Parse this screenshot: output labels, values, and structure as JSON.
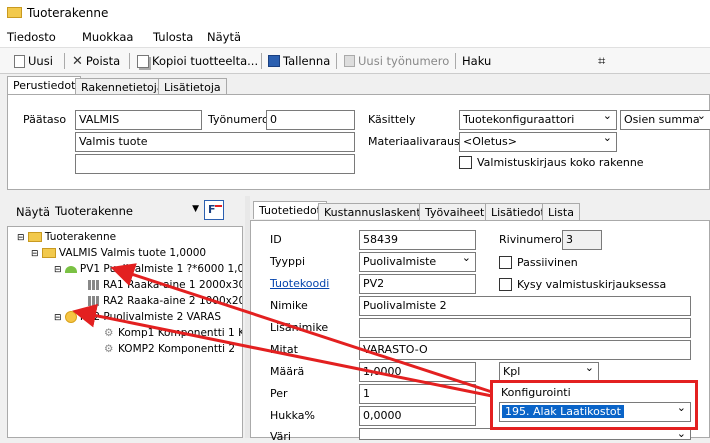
{
  "window": {
    "title": "Tuoterakenne"
  },
  "menu": [
    "Tiedosto",
    "Muokkaa",
    "Tulosta",
    "Näytä"
  ],
  "toolbar": {
    "new": "Uusi",
    "delete": "Poista",
    "copy": "Kopioi tuotteelta...",
    "save": "Tallenna",
    "new_worknum": "Uusi työnumero",
    "search": "Haku"
  },
  "top_tabs": [
    "Perustiedot",
    "Rakennetietoja",
    "Lisätietoja"
  ],
  "header": {
    "paataso_label": "Päätaso",
    "paataso_value": "VALMIS",
    "paataso_desc": "Valmis tuote",
    "tyonumero_label": "Työnumero",
    "tyonumero_value": "0",
    "kasittely_label": "Käsittely",
    "kasittely_value": "Tuotekonfiguraattori",
    "osien_summa": "Osien summa",
    "materiaalivaraus_label": "Materiaalivaraus",
    "materiaalivaraus_value": "<Oletus>",
    "valmistuskirjaus_label": "Valmistuskirjaus koko rakenne"
  },
  "tree_panel": {
    "nayta_label": "Näytä",
    "nayta_value": "Tuoterakenne",
    "nodes": [
      {
        "text": "Tuoterakenne"
      },
      {
        "text": "VALMIS  Valmis tuote  1,0000"
      },
      {
        "text": "PV1  Puolivalmiste 1 ?*6000  1,0"
      },
      {
        "text": "RA1  Raaka-aine 1 2000x30"
      },
      {
        "text": "RA2  Raaka-aine 2 1000x20"
      },
      {
        "text": "PV2  Puolivalmiste 2 VARAS"
      },
      {
        "text": "Komp1  Komponentti 1 K"
      },
      {
        "text": "KOMP2  Komponentti 2"
      }
    ]
  },
  "detail_tabs": [
    "Tuotetiedot",
    "Kustannuslaskenta",
    "Työvaiheet",
    "Lisätiedot",
    "Lista"
  ],
  "detail": {
    "id_label": "ID",
    "id_value": "58439",
    "rivinumero_label": "Rivinumero",
    "rivinumero_value": "3",
    "tyyppi_label": "Tyyppi",
    "tyyppi_value": "Puolivalmiste",
    "passiivinen_label": "Passiivinen",
    "tuotekoodi_label": "Tuotekoodi",
    "tuotekoodi_value": "PV2",
    "kysy_label": "Kysy valmistuskirjauksessa",
    "nimike_label": "Nimike",
    "nimike_value": "Puolivalmiste 2",
    "lisanimike_label": "Lisänimike",
    "lisanimike_value": "",
    "mitat_label": "Mitat",
    "mitat_value": "VARASTO-O",
    "maara_label": "Määrä",
    "maara_value": "1,0000",
    "yksikko_value": "Kpl",
    "per_label": "Per",
    "per_value": "1",
    "konfigurointi_label": "Konfigurointi",
    "konfigurointi_value": "195. Alak Laatikostot",
    "hukka_label": "Hukka%",
    "hukka_value": "0,0000",
    "vari_label": "Väri"
  },
  "colors": {
    "accent": "#e32020",
    "selection": "#0a64c8",
    "link": "#0645ad"
  }
}
